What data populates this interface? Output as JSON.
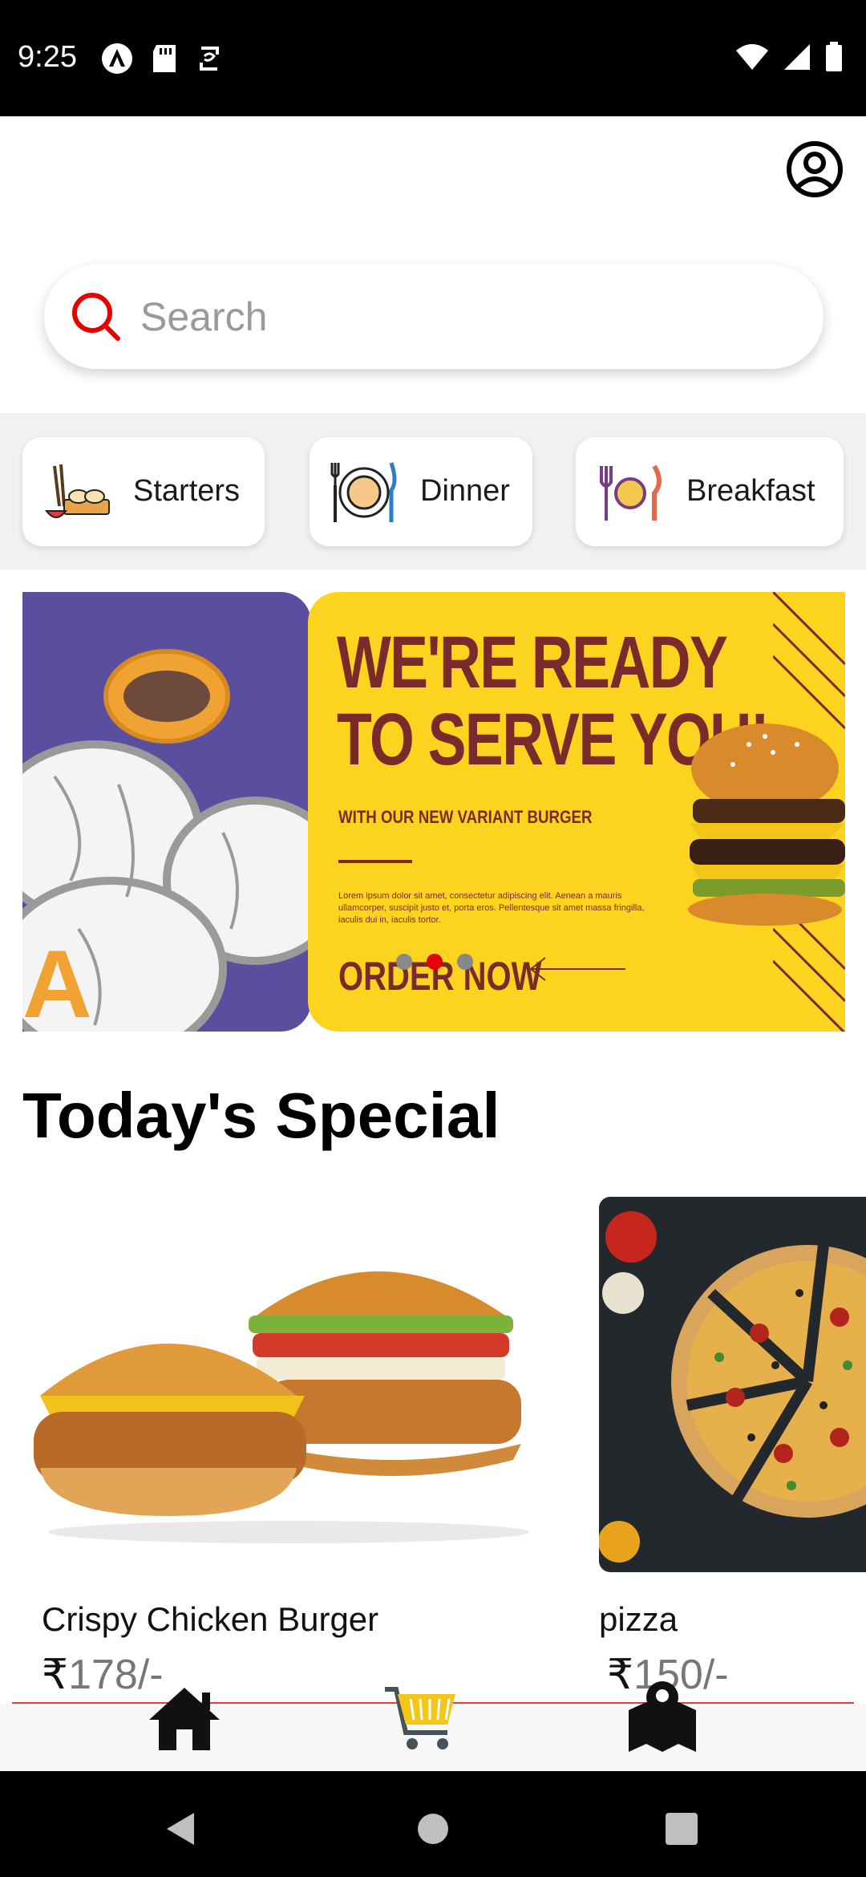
{
  "status_bar": {
    "time": "9:25"
  },
  "header": {
    "profile_icon": "account-circle-icon"
  },
  "search": {
    "placeholder": "Search",
    "value": ""
  },
  "categories": [
    {
      "label": "Starters",
      "icon": "starters-food-icon"
    },
    {
      "label": "Dinner",
      "icon": "dinner-plate-icon"
    },
    {
      "label": "Breakfast",
      "icon": "breakfast-cutlery-icon"
    }
  ],
  "banner": {
    "title_line1": "WE'RE READY",
    "title_line2": "TO SERVE YOU!",
    "subtitle": "WITH OUR NEW VARIANT BURGER",
    "body": "Lorem ipsum dolor sit amet, consectetur adipiscing elit. Aenean a mauris ullamcorper, suscipit justo et, porta eros. Pellentesque sit amet massa fringilla, iaculis dui in, iaculis tortor.",
    "cta": "ORDER NOW",
    "left_letter": "A",
    "active_slide": 2,
    "slide_count": 3
  },
  "section": {
    "title": "Today's Special"
  },
  "products": [
    {
      "name": "Crispy Chicken Burger",
      "currency": "₹",
      "price": "178/-"
    },
    {
      "name": "pizza",
      "currency": "₹",
      "price": "150/-"
    }
  ],
  "bottom_nav": [
    {
      "icon": "home-icon"
    },
    {
      "icon": "cart-icon"
    },
    {
      "icon": "map-icon"
    }
  ],
  "colors": {
    "accent": "#e60000",
    "banner_yellow": "#fcd31f",
    "banner_text": "#7a2a2a",
    "banner_purple": "#5a4f9e",
    "cart_yellow": "#f5c518"
  }
}
